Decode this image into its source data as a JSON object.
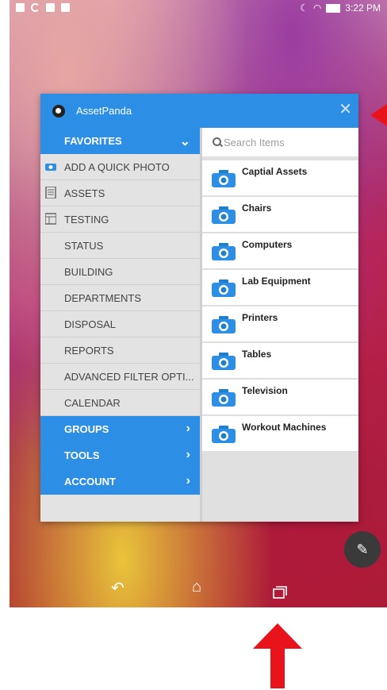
{
  "status": {
    "time": "3:22 PM"
  },
  "app": {
    "title": "AssetPanda",
    "close": "✕"
  },
  "menu": {
    "favorites": "FAVORITES",
    "items": [
      "ADD A QUICK PHOTO",
      "ASSETS",
      "TESTING",
      "STATUS",
      "BUILDING",
      "DEPARTMENTS",
      "DISPOSAL",
      "REPORTS",
      "ADVANCED FILTER OPTI...",
      "CALENDAR"
    ],
    "groups": "GROUPS",
    "tools": "TOOLS",
    "account": "ACCOUNT"
  },
  "search": {
    "placeholder": "Search Items"
  },
  "entities": [
    "Captial Assets",
    "Chairs",
    "Computers",
    "Lab Equipment",
    "Printers",
    "Tables",
    "Television",
    "Workout Machines"
  ],
  "icons": {
    "camera": "camera-icon",
    "back": "back-icon",
    "home": "home-icon",
    "recents": "recent-apps-icon",
    "fab": "edit-list-icon"
  },
  "colors": {
    "accent": "#2d8ee6",
    "annotation": "#e8131b"
  }
}
